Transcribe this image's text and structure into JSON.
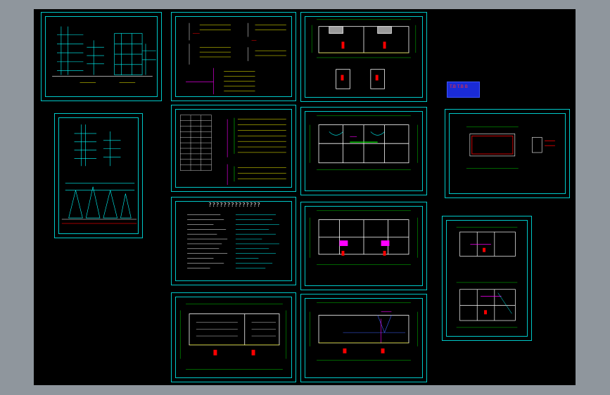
{
  "window": {
    "background_color": "#8f969d",
    "canvas_color": "#000000",
    "frame_color": "#00c8c8"
  },
  "sheets": [
    {
      "id": "riser-1"
    },
    {
      "id": "riser-2"
    },
    {
      "id": "system-1"
    },
    {
      "id": "system-2"
    },
    {
      "id": "notes",
      "title": "??????????????"
    },
    {
      "id": "plan-1"
    },
    {
      "id": "plan-2"
    },
    {
      "id": "plan-3"
    },
    {
      "id": "plan-4"
    },
    {
      "id": "plan-5"
    },
    {
      "id": "detail-1"
    },
    {
      "id": "detail-2"
    }
  ],
  "legend": {
    "text": "T.B T.B B"
  }
}
